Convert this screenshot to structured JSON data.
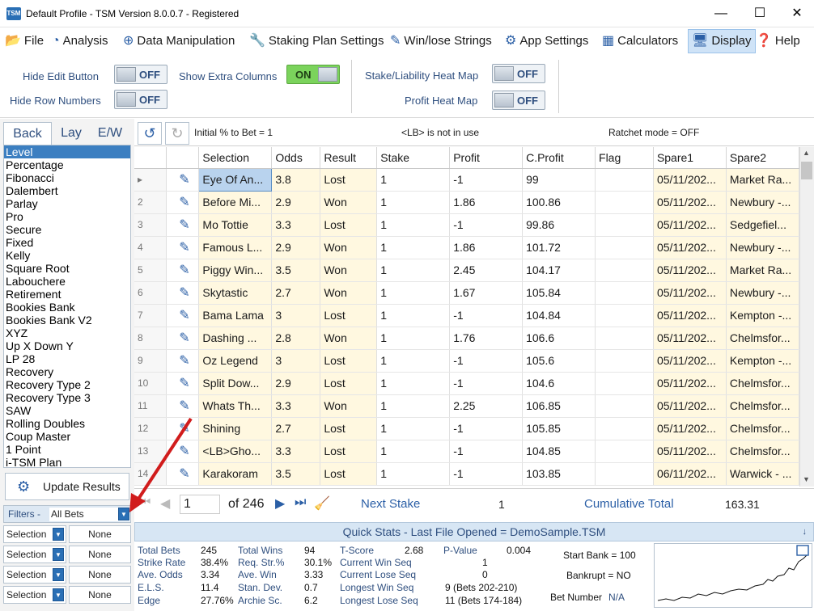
{
  "window": {
    "title": "Default Profile  -  TSM Version 8.0.0.7 - Registered",
    "icon_text": "TSM"
  },
  "menu": {
    "file": "File",
    "analysis": "Analysis",
    "data_manipulation": "Data Manipulation",
    "staking_plan_settings": "Staking Plan Settings",
    "winlose_strings": "Win/lose Strings",
    "app_settings": "App Settings",
    "calculators": "Calculators",
    "display": "Display",
    "help": "Help"
  },
  "settings": {
    "hide_edit_button": {
      "label": "Hide Edit Button",
      "state": "OFF"
    },
    "hide_row_numbers": {
      "label": "Hide Row Numbers",
      "state": "OFF"
    },
    "show_extra_columns": {
      "label": "Show Extra Columns",
      "state": "ON"
    },
    "stake_heat_map": {
      "label": "Stake/Liability Heat Map",
      "state": "OFF"
    },
    "profit_heat_map": {
      "label": "Profit Heat Map",
      "state": "OFF"
    }
  },
  "left": {
    "tabs": [
      "Back",
      "Lay",
      "E/W"
    ],
    "plans": [
      "Level",
      "Percentage",
      "Fibonacci",
      "Dalembert",
      "Parlay",
      "Pro",
      "Secure",
      "Fixed",
      "Kelly",
      "Square Root",
      "Labouchere",
      "Retirement",
      "Bookies Bank",
      "Bookies Bank V2",
      "XYZ",
      "Up X Down Y",
      "LP 28",
      "Recovery",
      "Recovery Type 2",
      "Recovery Type 3",
      "SAW",
      "Rolling Doubles",
      "Coup Master",
      "1 Point",
      "i-TSM Plan"
    ],
    "update_results": "Update Results",
    "filters_label": "Filters -",
    "filters_value": "All Bets",
    "filter_rows": [
      {
        "select": "Selection",
        "value": "None"
      },
      {
        "select": "Selection",
        "value": "None"
      },
      {
        "select": "Selection",
        "value": "None"
      },
      {
        "select": "Selection",
        "value": "None"
      }
    ]
  },
  "toolbar": {
    "initial_pct": "Initial % to Bet = 1",
    "lb_status": "<LB> is not in use",
    "ratchet": "Ratchet mode = OFF"
  },
  "grid": {
    "columns": [
      "",
      "",
      "Selection",
      "Odds",
      "Result",
      "Stake",
      "Profit",
      "C.Profit",
      "Flag",
      "Spare1",
      "Spare2"
    ],
    "rows": [
      {
        "n": "",
        "sel": "Eye Of An...",
        "odds": "3.8",
        "res": "Lost",
        "stake": "1",
        "profit": "-1",
        "cp": "99",
        "flag": "",
        "s1": "05/11/202...",
        "s2": "Market Ra..."
      },
      {
        "n": "2",
        "sel": "Before Mi...",
        "odds": "2.9",
        "res": "Won",
        "stake": "1",
        "profit": "1.86",
        "cp": "100.86",
        "flag": "",
        "s1": "05/11/202...",
        "s2": "Newbury -..."
      },
      {
        "n": "3",
        "sel": "Mo Tottie",
        "odds": "3.3",
        "res": "Lost",
        "stake": "1",
        "profit": "-1",
        "cp": "99.86",
        "flag": "",
        "s1": "05/11/202...",
        "s2": "Sedgefiel..."
      },
      {
        "n": "4",
        "sel": "Famous L...",
        "odds": "2.9",
        "res": "Won",
        "stake": "1",
        "profit": "1.86",
        "cp": "101.72",
        "flag": "",
        "s1": "05/11/202...",
        "s2": "Newbury -..."
      },
      {
        "n": "5",
        "sel": "Piggy Win...",
        "odds": "3.5",
        "res": "Won",
        "stake": "1",
        "profit": "2.45",
        "cp": "104.17",
        "flag": "",
        "s1": "05/11/202...",
        "s2": "Market Ra..."
      },
      {
        "n": "6",
        "sel": "Skytastic",
        "odds": "2.7",
        "res": "Won",
        "stake": "1",
        "profit": "1.67",
        "cp": "105.84",
        "flag": "",
        "s1": "05/11/202...",
        "s2": "Newbury -..."
      },
      {
        "n": "7",
        "sel": "Bama Lama",
        "odds": "3",
        "res": "Lost",
        "stake": "1",
        "profit": "-1",
        "cp": "104.84",
        "flag": "",
        "s1": "05/11/202...",
        "s2": "Kempton -..."
      },
      {
        "n": "8",
        "sel": "Dashing ...",
        "odds": "2.8",
        "res": "Won",
        "stake": "1",
        "profit": "1.76",
        "cp": "106.6",
        "flag": "",
        "s1": "05/11/202...",
        "s2": "Chelmsfor..."
      },
      {
        "n": "9",
        "sel": "Oz Legend",
        "odds": "3",
        "res": "Lost",
        "stake": "1",
        "profit": "-1",
        "cp": "105.6",
        "flag": "",
        "s1": "05/11/202...",
        "s2": "Kempton -..."
      },
      {
        "n": "10",
        "sel": "Split Dow...",
        "odds": "2.9",
        "res": "Lost",
        "stake": "1",
        "profit": "-1",
        "cp": "104.6",
        "flag": "",
        "s1": "05/11/202...",
        "s2": "Chelmsfor..."
      },
      {
        "n": "11",
        "sel": "Whats Th...",
        "odds": "3.3",
        "res": "Won",
        "stake": "1",
        "profit": "2.25",
        "cp": "106.85",
        "flag": "",
        "s1": "05/11/202...",
        "s2": "Chelmsfor..."
      },
      {
        "n": "12",
        "sel": "Shining",
        "odds": "2.7",
        "res": "Lost",
        "stake": "1",
        "profit": "-1",
        "cp": "105.85",
        "flag": "",
        "s1": "05/11/202...",
        "s2": "Chelmsfor..."
      },
      {
        "n": "13",
        "sel": "<LB>Gho...",
        "odds": "3.3",
        "res": "Lost",
        "stake": "1",
        "profit": "-1",
        "cp": "104.85",
        "flag": "",
        "s1": "05/11/202...",
        "s2": "Chelmsfor..."
      },
      {
        "n": "14",
        "sel": "Karakoram",
        "odds": "3.5",
        "res": "Lost",
        "stake": "1",
        "profit": "-1",
        "cp": "103.85",
        "flag": "",
        "s1": "06/11/202...",
        "s2": "Warwick - ..."
      }
    ]
  },
  "nav": {
    "page": "1",
    "of_total": "of 246",
    "next_stake_label": "Next Stake",
    "next_stake_value": "1",
    "cumulative_label": "Cumulative Total",
    "cumulative_value": "163.31"
  },
  "quickstats": {
    "header": "Quick Stats - Last File Opened = DemoSample.TSM",
    "col1": [
      [
        "Total Bets",
        "245"
      ],
      [
        "Strike Rate",
        "38.4%"
      ],
      [
        "Ave. Odds",
        "3.34"
      ],
      [
        "E.L.S.",
        "11.4"
      ],
      [
        "Edge",
        "27.76%"
      ]
    ],
    "col2": [
      [
        "Total Wins",
        "94"
      ],
      [
        "Req. Str.%",
        "30.1%"
      ],
      [
        "Ave. Win",
        "3.33"
      ],
      [
        "Stan. Dev.",
        "0.7"
      ],
      [
        "Archie Sc.",
        "6.2"
      ]
    ],
    "tscore": [
      "T-Score",
      "2.68"
    ],
    "pvalue": [
      "P-Value",
      "0.004"
    ],
    "col3": [
      [
        "Current Win Seq",
        "1"
      ],
      [
        "Current Lose Seq",
        "0"
      ],
      [
        "Longest Win Seq",
        "9  (Bets 202-210)"
      ],
      [
        "Longest Lose Seq",
        "11  (Bets 174-184)"
      ]
    ],
    "start_bank": "Start Bank = 100",
    "bankrupt": "Bankrupt = NO",
    "bet_number_label": "Bet Number",
    "bet_number_value": "N/A"
  },
  "colors": {
    "accent": "#2b5fa6",
    "selected": "#3c7fc1",
    "toggle_on": "#7bd35c",
    "arrow": "#d11c1c",
    "cell_highlight": "#fff8e0"
  }
}
